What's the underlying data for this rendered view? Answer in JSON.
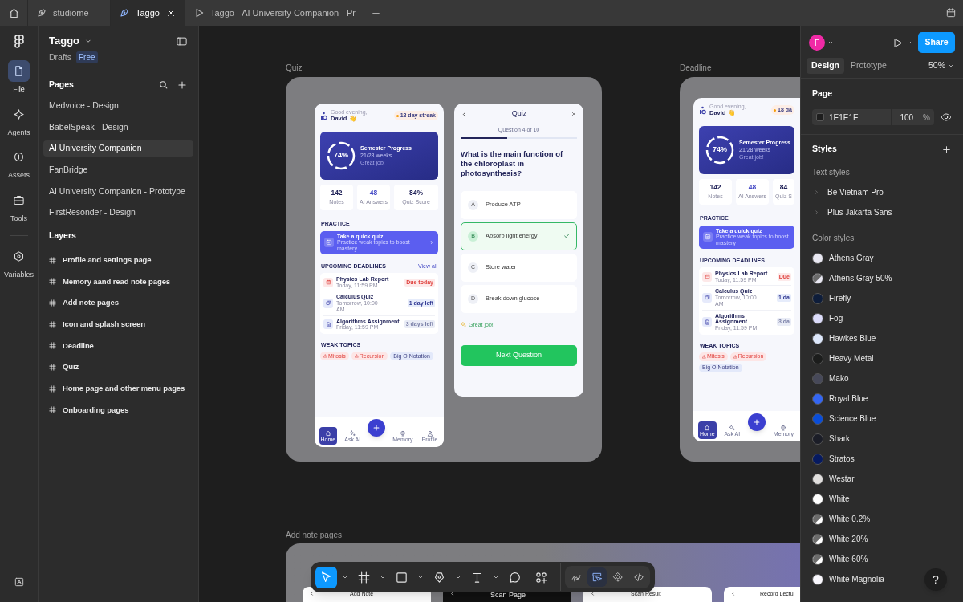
{
  "tabs": [
    {
      "label": "studiome",
      "kind": "design",
      "selected": false,
      "closable": false
    },
    {
      "label": "Taggo",
      "kind": "design",
      "selected": true,
      "closable": true
    },
    {
      "label": "Taggo - AI University Companion - Pr",
      "kind": "prototype",
      "selected": false,
      "closable": false
    }
  ],
  "rail": [
    {
      "label": "File",
      "kind": "file",
      "selected": true
    },
    {
      "label": "Agents",
      "kind": "agents",
      "selected": false
    },
    {
      "label": "Assets",
      "kind": "assets",
      "selected": false
    },
    {
      "label": "Tools",
      "kind": "tools",
      "selected": false
    },
    {
      "label": "Variables",
      "kind": "variables",
      "selected": false
    }
  ],
  "file": {
    "name": "Taggo",
    "location": "Drafts",
    "plan": "Free"
  },
  "pages": {
    "title": "Pages",
    "items": [
      {
        "label": "Medvoice - Design",
        "selected": false
      },
      {
        "label": "BabelSpeak - Design",
        "selected": false
      },
      {
        "label": "AI University Companion",
        "selected": true
      },
      {
        "label": "FanBridge",
        "selected": false
      },
      {
        "label": "AI University Companion - Prototype",
        "selected": false
      },
      {
        "label": "FirstResonder - Design",
        "selected": false
      }
    ]
  },
  "layers": {
    "title": "Layers",
    "items": [
      "Profile and settings page",
      "Memory aand read note pages",
      "Add note pages",
      "Icon and splash screen",
      "Deadline",
      "Quiz",
      "Home page and other menu pages",
      "Onboarding pages"
    ]
  },
  "canvas": {
    "quiz_frame": {
      "label": "Quiz",
      "home": {
        "greeting": "Good evening,",
        "name": "David 👋",
        "streak": "18 day streak",
        "progress": {
          "percent": "74%",
          "title": "Semester Progress",
          "weeks": "21/28 weeks",
          "note": "Great job!"
        },
        "stats": [
          {
            "value": "142",
            "label": "Notes"
          },
          {
            "value": "48",
            "label": "AI Answers"
          },
          {
            "value": "84%",
            "label": "Quiz Score"
          }
        ],
        "practice": {
          "title": "PRACTICE",
          "card_title": "Take a quick quiz",
          "card_subtitle": "Practice weak topics to boost mastery"
        },
        "deadlines": {
          "title": "UPCOMING DEADLINES",
          "link": "View all",
          "items": [
            {
              "title": "Physics Lab Report",
              "time": "Today, 11:59 PM",
              "badge": "Due today",
              "kind": "urgent"
            },
            {
              "title": "Calculus Quiz",
              "time": "Tomorrow, 10:00 AM",
              "badge": "1 day left",
              "kind": "soon"
            },
            {
              "title": "Algorithms Assignment",
              "time": "Friday, 11:59 PM",
              "badge": "3 days left",
              "kind": "later"
            }
          ]
        },
        "weak_topics": {
          "title": "WEAK TOPICS",
          "items": [
            {
              "label": "Mitosis",
              "kind": "warning"
            },
            {
              "label": "Recursion",
              "kind": "warning"
            },
            {
              "label": "Big O Notation",
              "kind": "neutral"
            }
          ]
        },
        "nav": [
          {
            "label": "Home",
            "kind": "home",
            "selected": true
          },
          {
            "label": "Ask AI",
            "kind": "ai",
            "selected": false
          },
          {
            "label": "Memory",
            "kind": "memory",
            "selected": false
          },
          {
            "label": "Profile",
            "kind": "profile",
            "selected": false
          }
        ]
      },
      "quiz": {
        "title": "Quiz",
        "counter": "Question 4 of 10",
        "level": 0.4,
        "question": "What is the main function of the chloroplast in photosynthesis?",
        "options": [
          {
            "letter": "A",
            "text": "Produce ATP",
            "selected": false
          },
          {
            "letter": "B",
            "text": "Absorb light energy",
            "selected": true
          },
          {
            "letter": "C",
            "text": "Store water",
            "selected": false
          },
          {
            "letter": "D",
            "text": "Break down glucose",
            "selected": false
          }
        ],
        "feedback": "Great job!",
        "button": "Next Question"
      }
    },
    "deadline_frame": {
      "label": "Deadline",
      "home": {
        "greeting": "Good evening,",
        "name": "David 👋",
        "streak": "18 da",
        "progress": {
          "percent": "74%",
          "title": "Semester Progress",
          "weeks": "21/28 weeks",
          "note": "Great job!"
        },
        "stats": [
          {
            "value": "142",
            "label": "Notes"
          },
          {
            "value": "48",
            "label": "AI Answers"
          },
          {
            "value": "84",
            "label": "Quiz S"
          }
        ],
        "practice": {
          "title": "PRACTICE",
          "card_title": "Take a quick quiz",
          "card_subtitle": "Practice weak topics to boost mastery"
        },
        "deadlines": {
          "title": "UPCOMING DEADLINES",
          "items": [
            {
              "title": "Physics Lab Report",
              "time": "Today, 11:59 PM",
              "badge": "Due",
              "kind": "urgent"
            },
            {
              "title": "Calculus Quiz",
              "time": "Tomorrow, 10:00 AM",
              "badge": "1 da",
              "kind": "soon"
            },
            {
              "title": "Algorithms Assignment",
              "time": "Friday, 11:59 PM",
              "badge": "3 da",
              "kind": "later"
            }
          ]
        },
        "weak_topics": {
          "title": "WEAK TOPICS",
          "items": [
            {
              "label": "Mitosis",
              "kind": "warning"
            },
            {
              "label": "Recursion",
              "kind": "warning"
            },
            {
              "label": "Big O Notation",
              "kind": "neutral"
            }
          ]
        },
        "nav": [
          {
            "label": "Home",
            "kind": "home",
            "selected": true
          },
          {
            "label": "Ask AI",
            "kind": "ai",
            "selected": false
          },
          {
            "label": "Memory",
            "kind": "memory",
            "selected": false
          }
        ]
      }
    },
    "add_note_frame": {
      "label": "Add note pages",
      "cards": [
        {
          "title": "Add Note",
          "kind": "light"
        },
        {
          "title": "Scan Page",
          "kind": "dark"
        },
        {
          "title": "Scan Result",
          "kind": "light"
        },
        {
          "title": "Record Lectu",
          "kind": "light"
        }
      ]
    }
  },
  "toolbar": {
    "tools": [
      {
        "kind": "move",
        "selected": true
      },
      {
        "kind": "frame",
        "selected": false
      },
      {
        "kind": "shape",
        "selected": false
      },
      {
        "kind": "pen",
        "selected": false
      },
      {
        "kind": "text",
        "selected": false
      },
      {
        "kind": "comment",
        "selected": false
      },
      {
        "kind": "actions",
        "selected": false
      }
    ],
    "modes": [
      {
        "kind": "draw",
        "selected": false
      },
      {
        "kind": "design",
        "selected": true
      },
      {
        "kind": "component",
        "selected": false
      },
      {
        "kind": "dev",
        "selected": false
      }
    ]
  },
  "right_panel": {
    "avatar": "F",
    "share": "Share",
    "tabs": [
      {
        "label": "Design",
        "selected": true
      },
      {
        "label": "Prototype",
        "selected": false
      }
    ],
    "zoom": "50%",
    "page": {
      "title": "Page",
      "color": "#1e1e1e",
      "hex": "1E1E1E",
      "opacity": "100",
      "unit": "%"
    },
    "styles": {
      "title": "Styles",
      "text_title": "Text styles",
      "text_styles": [
        "Be Vietnam Pro",
        "Plus Jakarta Sans"
      ],
      "color_title": "Color styles",
      "colors": [
        {
          "name": "Athens Gray",
          "color": "#e9e8f2",
          "translucent": false
        },
        {
          "name": "Athens Gray 50%",
          "color": "#e9e8f2",
          "translucent": true
        },
        {
          "name": "Firefly",
          "color": "#0e1d3a",
          "translucent": false
        },
        {
          "name": "Fog",
          "color": "#dcdcfa",
          "translucent": false
        },
        {
          "name": "Hawkes Blue",
          "color": "#dde7fb",
          "translucent": false
        },
        {
          "name": "Heavy Metal",
          "color": "#1c1d1c",
          "translucent": false
        },
        {
          "name": "Mako",
          "color": "#474959",
          "translucent": false
        },
        {
          "name": "Royal Blue",
          "color": "#3466f2",
          "translucent": false
        },
        {
          "name": "Science Blue",
          "color": "#0a4dd8",
          "translucent": false
        },
        {
          "name": "Shark",
          "color": "#1b1d27",
          "translucent": false
        },
        {
          "name": "Stratos",
          "color": "#061a60",
          "translucent": false
        },
        {
          "name": "Westar",
          "color": "#e1dfde",
          "translucent": false
        },
        {
          "name": "White",
          "color": "#ffffff",
          "translucent": false
        },
        {
          "name": "White 0.2%",
          "color": "#ffffff",
          "translucent": true
        },
        {
          "name": "White 20%",
          "color": "#ffffff",
          "translucent": true
        },
        {
          "name": "White 60%",
          "color": "#ffffff",
          "translucent": true
        },
        {
          "name": "White Magnolia",
          "color": "#f9f7fd",
          "translucent": false
        }
      ]
    },
    "help": "?"
  }
}
